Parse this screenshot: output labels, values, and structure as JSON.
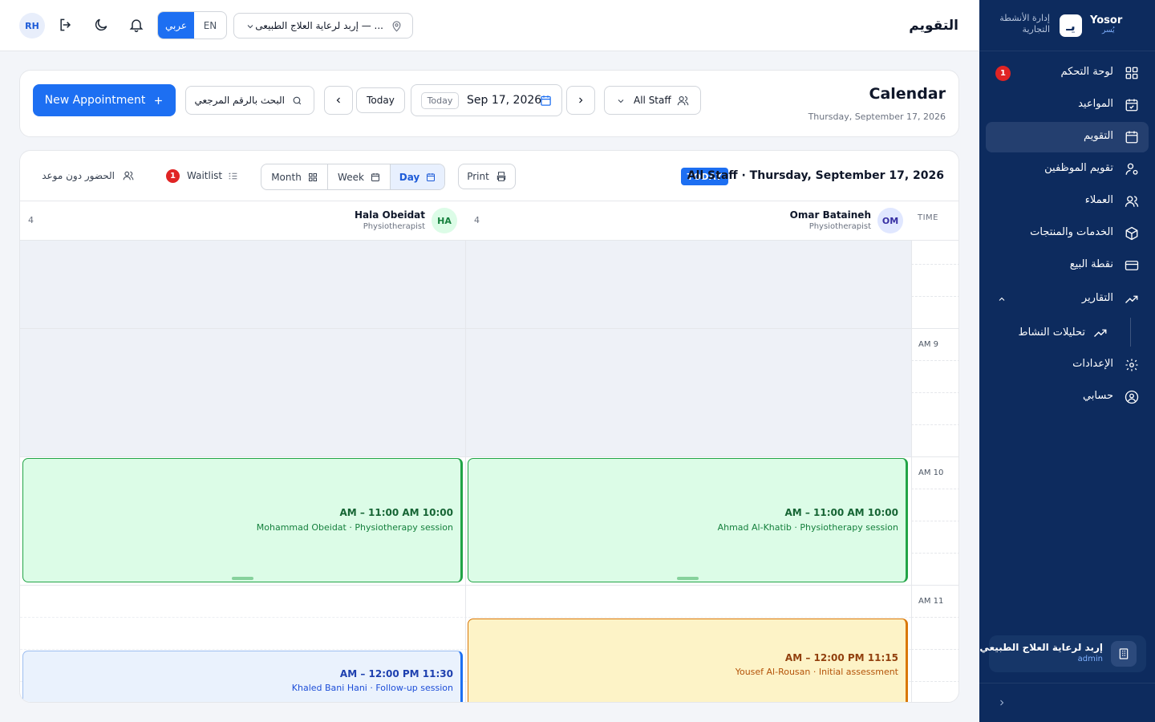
{
  "sidebar": {
    "brand_name": "Yosor",
    "brand_sub": "يُسر",
    "brand_logo": "يـ",
    "brand_tagline": "إدارة الأنشطة التجارية",
    "items": [
      {
        "label": "لوحة التحكم",
        "icon": "grid-icon",
        "badge": "1"
      },
      {
        "label": "المواعيد",
        "icon": "calendar-check-icon"
      },
      {
        "label": "التقويم",
        "icon": "calendar-icon",
        "active": true
      },
      {
        "label": "تقويم الموظفين",
        "icon": "user-gear-icon"
      },
      {
        "label": "العملاء",
        "icon": "users-icon"
      },
      {
        "label": "الخدمات والمنتجات",
        "icon": "box-icon"
      },
      {
        "label": "نقطة البيع",
        "icon": "credit-card-icon"
      },
      {
        "label": "التقارير",
        "icon": "trend-up-icon",
        "expanded": true
      },
      {
        "label": "الإعدادات",
        "icon": "gear-icon"
      },
      {
        "label": "حسابي",
        "icon": "user-circle-icon"
      }
    ],
    "sub_items": [
      {
        "label": "تحليلات النشاط",
        "icon": "trend-up-icon"
      }
    ],
    "tenant": {
      "name": "إربد لرعاية العلاج الطبيعي",
      "role": "admin"
    }
  },
  "topbar": {
    "page_title": "التقويم",
    "avatar_initials": "RH",
    "lang_ar": "عربي",
    "lang_en": "EN",
    "branch": "إربد لرعاية العلاج الطبيعى — ..."
  },
  "calendar_header": {
    "title": "Calendar",
    "subtitle": "Thursday, September 17, 2026",
    "new_appointment": "New Appointment",
    "search_placeholder": "البحث بالرقم المرجعي",
    "today_button": "Today",
    "date_chip": "Today",
    "date_value": "Sep 17, 2026",
    "staff_filter": "All Staff"
  },
  "toolbar": {
    "today_badge": "TODAY",
    "view_title": "All Staff · Thursday, September 17, 2026",
    "print": "Print",
    "views": [
      {
        "label": "Month"
      },
      {
        "label": "Week"
      },
      {
        "label": "Day",
        "active": true
      }
    ],
    "waitlist_label": "Waitlist",
    "waitlist_count": "1",
    "walkin_label": "الحضور دون موعد"
  },
  "columns": {
    "time_header": "TIME",
    "staff": [
      {
        "name": "Omar Bataineh",
        "role": "Physiotherapist",
        "initials": "OM",
        "count": "4"
      },
      {
        "name": "Hala Obeidat",
        "role": "Physiotherapist",
        "initials": "HA",
        "count": "4"
      }
    ]
  },
  "time_labels": [
    "AM 9",
    "AM 10",
    "AM 11"
  ],
  "appointments": [
    {
      "staff": 0,
      "time": "AM – 11:00 AM 10:00",
      "desc": "Ahmad Al-Khatib · Physiotherapy session",
      "status": "green"
    },
    {
      "staff": 1,
      "time": "AM – 11:00 AM 10:00",
      "desc": "Mohammad Obeidat · Physiotherapy session",
      "status": "green"
    },
    {
      "staff": 0,
      "time": "AM – 12:00 PM 11:15",
      "desc": "Yousef Al-Rousan · Initial assessment",
      "status": "amber"
    },
    {
      "staff": 1,
      "time": "AM – 12:00 PM 11:30",
      "desc": "Khaled Bani Hani · Follow-up session",
      "status": "blue"
    }
  ],
  "colors": {
    "sidebar": "#0d2b5e",
    "primary": "#1d6ff2",
    "badge": "#e02424"
  }
}
